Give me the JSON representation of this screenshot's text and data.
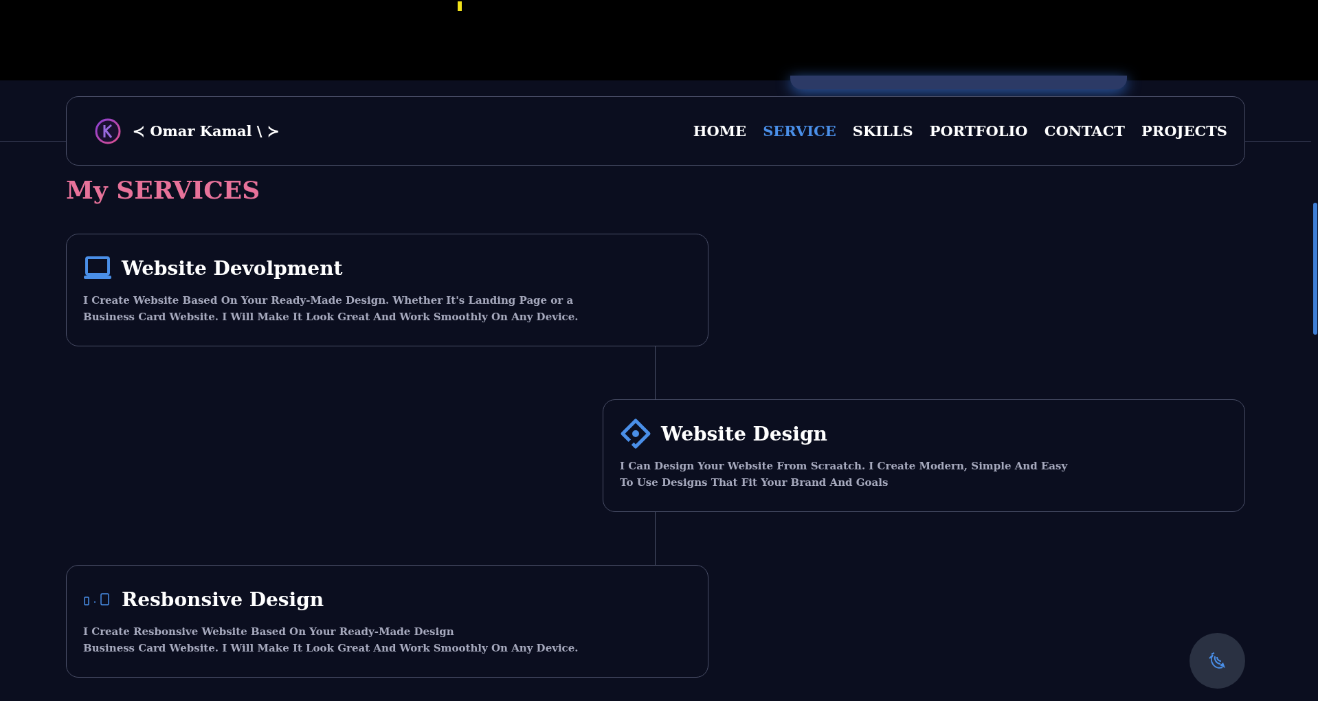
{
  "navbar": {
    "brand": "≺ Omar Kamal \\ ≻",
    "links": [
      {
        "label": "HOME",
        "selected": false
      },
      {
        "label": "SERVICE",
        "selected": true
      },
      {
        "label": "SKILLS",
        "selected": false
      },
      {
        "label": "PORTFOLIO",
        "selected": false
      },
      {
        "label": "CONTACT",
        "selected": false
      },
      {
        "label": "PROJECTS",
        "selected": false
      }
    ]
  },
  "section_title": "My SERVICES",
  "services": [
    {
      "kind": "laptop",
      "title": "Website Devolpment",
      "lines": [
        "I Create Website Based On Your Ready-Made Design. Whether It's Landing Page or a",
        "Business Card Website. I Will Make It Look Great And Work Smoothly On Any Device."
      ]
    },
    {
      "kind": "diamond",
      "title": "Website Design",
      "lines": [
        "I Can Design Your Website From Scraatch. I Create Modern, Simple And Easy",
        "To Use Designs That Fit Your Brand And Goals"
      ]
    },
    {
      "kind": "devices",
      "title": "Resbonsive Design",
      "lines": [
        "I Create Resbonsive Website Based On Your Ready-Made Design",
        "Business Card Website. I Will Make It Look Great And Work Smoothly On Any Device."
      ]
    }
  ]
}
